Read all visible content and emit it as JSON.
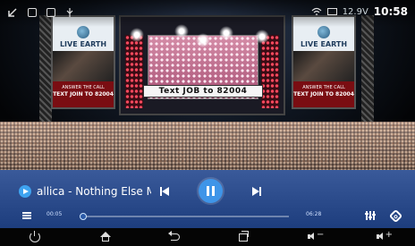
{
  "status_bar": {
    "voltage": "12.9V",
    "time": "10:58"
  },
  "video": {
    "stage_sign": "Text JOB to 82004",
    "screen_logo": "LIVE EARTH",
    "screen_caption_line1": "ANSWER THE CALL",
    "screen_caption_line2": "TEXT JOIN TO 82004"
  },
  "player": {
    "song_title": "allica - Nothing Else Mat",
    "elapsed": "00:05",
    "total": "06:28",
    "progress_fraction": 0.015
  }
}
